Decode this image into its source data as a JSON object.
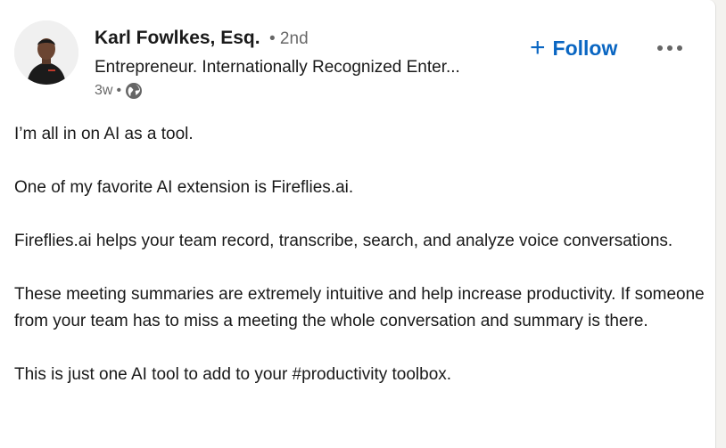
{
  "author": {
    "name": "Karl Fowlkes, Esq.",
    "degree": "• 2nd",
    "headline": "Entrepreneur. Internationally Recognized Enter...",
    "time": "3w",
    "visibility_icon": "globe-icon"
  },
  "actions": {
    "follow_label": "Follow",
    "follow_icon": "+",
    "more_icon": "more-horizontal-icon"
  },
  "post": {
    "paragraphs": [
      "I’m all in on AI as a tool.",
      "One of my favorite AI extension is Fireflies.ai.",
      "Fireflies.ai helps your team record, transcribe, search, and analyze voice conversations.",
      "These meeting summaries are extremely intuitive and help increase productivity. If someone from your team has to miss a meeting the whole conversation and summary is there.",
      "This is just one AI tool to add to your #productivity toolbox."
    ]
  },
  "colors": {
    "accent": "#0a66c2",
    "background": "#f3f2ef",
    "card": "#ffffff"
  }
}
